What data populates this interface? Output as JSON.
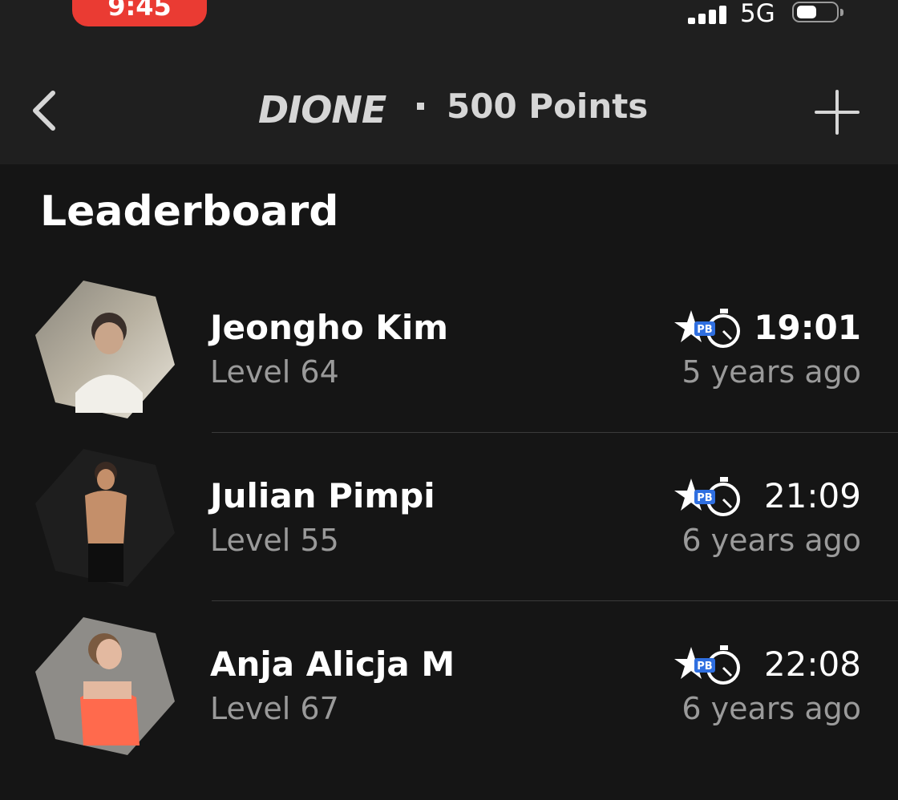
{
  "status_bar": {
    "time": "9:45",
    "network": "5G"
  },
  "header": {
    "brand": "DIONE",
    "separator": "·",
    "points": "500 Points",
    "icons": {
      "back": "chevron-left-icon",
      "add": "plus-icon"
    }
  },
  "leaderboard": {
    "title": "Leaderboard",
    "entries": [
      {
        "name": "Jeongho Kim",
        "level": "Level 64",
        "time": "19:01",
        "ago": "5 years ago",
        "badge": "PB"
      },
      {
        "name": "Julian Pimpi",
        "level": "Level 55",
        "time": "21:09",
        "ago": "6 years ago",
        "badge": "PB"
      },
      {
        "name": "Anja Alicja M",
        "level": "Level 67",
        "time": "22:08",
        "ago": "6 years ago",
        "badge": "PB"
      }
    ]
  },
  "colors": {
    "background": "#151515",
    "header": "#1f1f1f",
    "time_pill": "#ea3b33",
    "pb_badge": "#2f6fe0",
    "secondary_text": "#9a9a9a"
  }
}
